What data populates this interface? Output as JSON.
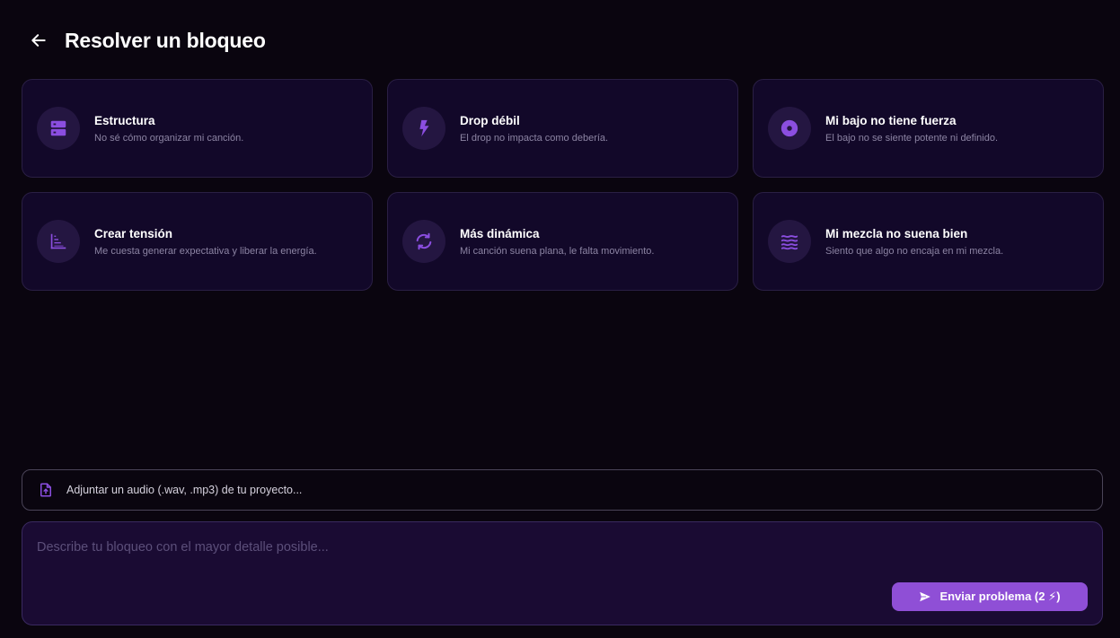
{
  "header": {
    "title": "Resolver un bloqueo"
  },
  "cards": [
    {
      "title": "Estructura",
      "description": "No sé cómo organizar mi canción.",
      "icon": "structure-icon"
    },
    {
      "title": "Drop débil",
      "description": "El drop no impacta como debería.",
      "icon": "lightning-icon"
    },
    {
      "title": "Mi bajo no tiene fuerza",
      "description": "El bajo no se siente potente ni definido.",
      "icon": "disc-icon"
    },
    {
      "title": "Crear tensión",
      "description": "Me cuesta generar expectativa y liberar la energía.",
      "icon": "rising-bars-icon"
    },
    {
      "title": "Más dinámica",
      "description": "Mi canción suena plana, le falta movimiento.",
      "icon": "refresh-icon"
    },
    {
      "title": "Mi mezcla no suena bien",
      "description": "Siento que algo no encaja en mi mezcla.",
      "icon": "waves-icon"
    }
  ],
  "attach": {
    "label": "Adjuntar un audio (.wav, .mp3) de tu proyecto...",
    "icon": "file-upload-icon"
  },
  "composer": {
    "placeholder": "Describe tu bloqueo con el mayor detalle posible...",
    "value": "",
    "send_label": "Enviar problema (2 ⚡)",
    "send_icon": "send-icon"
  },
  "colors": {
    "background": "#0a050f",
    "card_background": "#120829",
    "accent": "#8f4fd6",
    "icon_purple": "#8b4ee0"
  }
}
